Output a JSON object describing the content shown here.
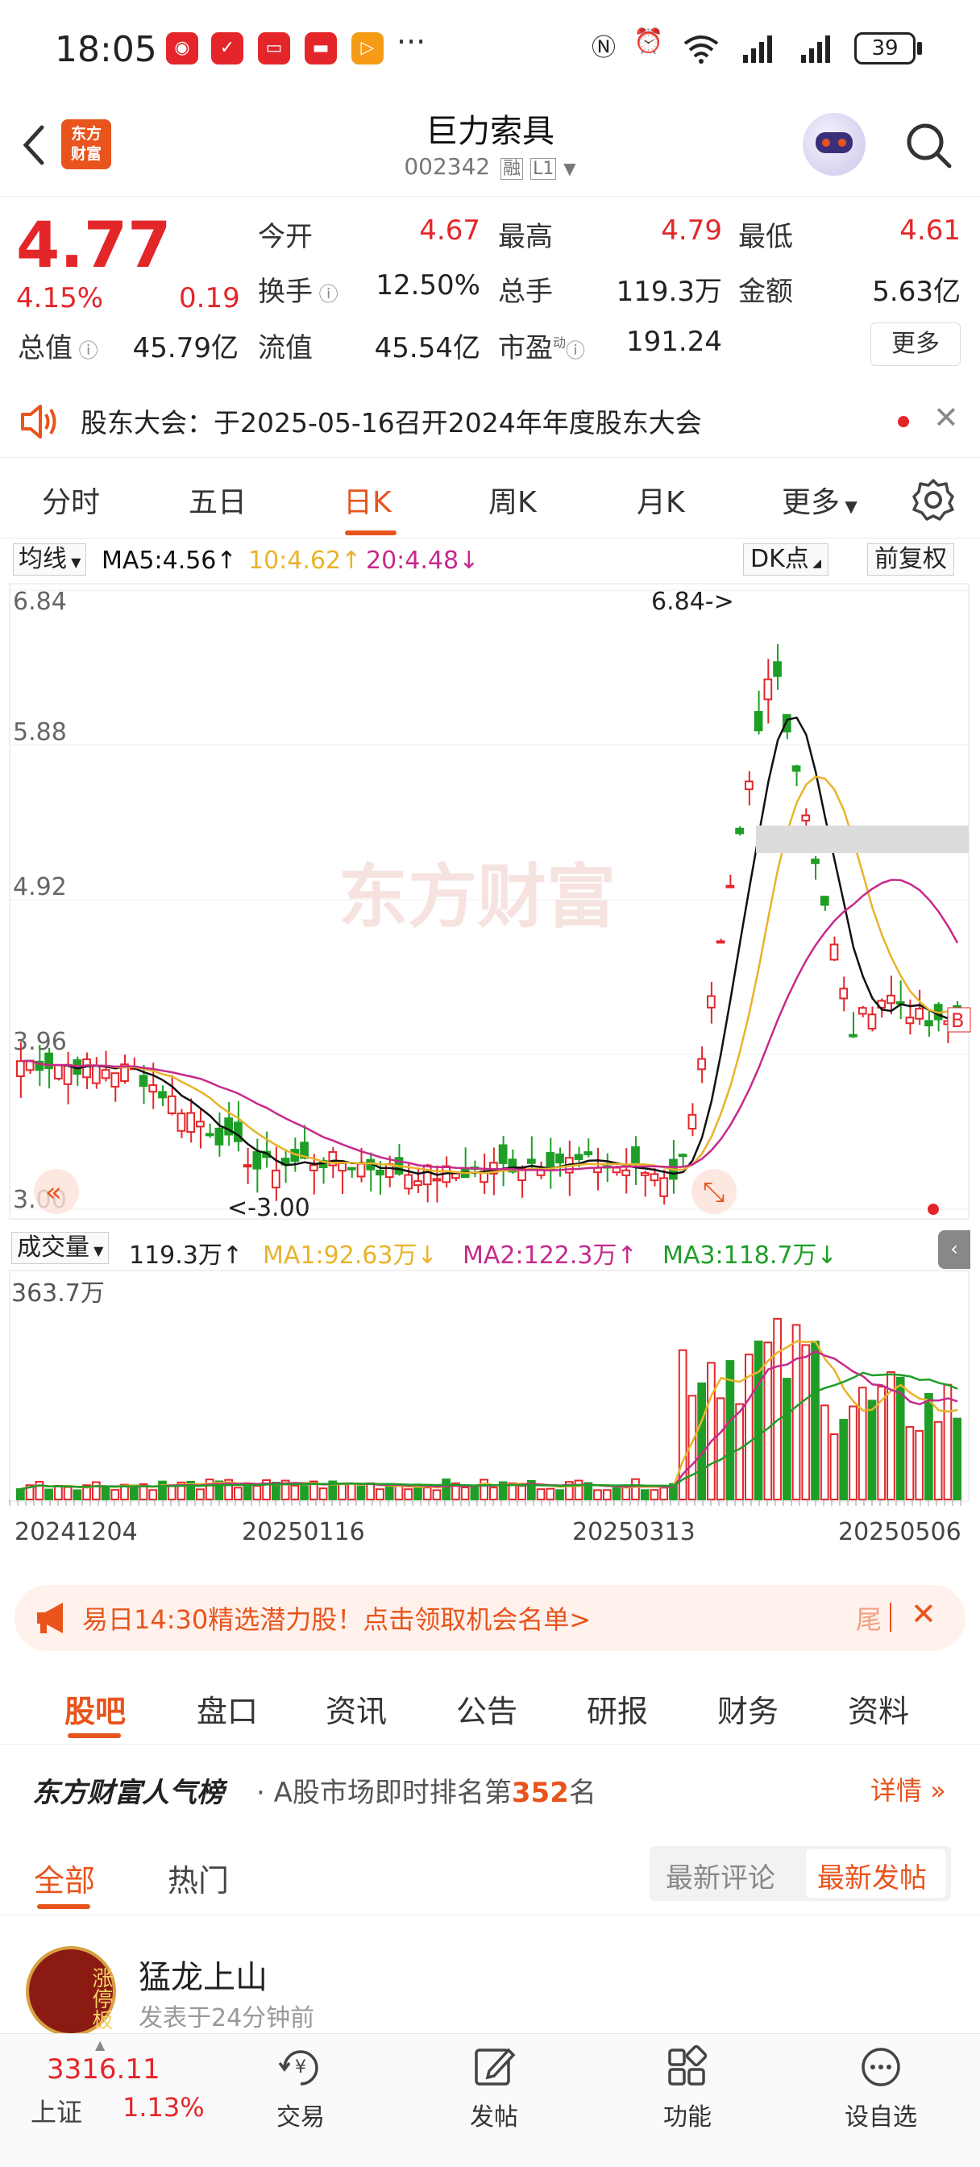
{
  "status": {
    "time": "18:05",
    "battery": "39"
  },
  "header": {
    "logo_line1": "东方",
    "logo_line2": "财富",
    "title": "巨力索具",
    "code": "002342",
    "tag1": "融",
    "tag2": "L1"
  },
  "quote": {
    "price": "4.77",
    "pct": "4.15%",
    "change": "0.19",
    "fields": [
      {
        "label": "今开",
        "value": "4.67",
        "red": true
      },
      {
        "label": "最高",
        "value": "4.79",
        "red": true
      },
      {
        "label": "最低",
        "value": "4.61",
        "red": true
      },
      {
        "label": "换手",
        "value": "12.50%",
        "red": false
      },
      {
        "label": "总手",
        "value": "119.3万",
        "red": false
      },
      {
        "label": "金额",
        "value": "5.63亿",
        "red": false
      },
      {
        "label": "总值",
        "value": "45.79亿",
        "red": false
      },
      {
        "label": "流值",
        "value": "45.54亿",
        "red": false
      },
      {
        "label": "市盈",
        "value": "191.24",
        "red": false
      }
    ],
    "more": "更多",
    "pe_sup": "动"
  },
  "notice": {
    "text": "股东大会：于2025-05-16召开2024年年度股东大会"
  },
  "tabs": [
    "分时",
    "五日",
    "日K",
    "周K",
    "月K",
    "更多"
  ],
  "ma": {
    "selector": "均线",
    "ma5": "MA5:4.56↑",
    "ma10": "10:4.62↑",
    "ma20": "20:4.48↓",
    "dk": "DK点",
    "fq": "前复权"
  },
  "chart_data": {
    "type": "candlestick",
    "y_ticks": [
      "6.84",
      "5.88",
      "4.92",
      "3.96",
      "3.00"
    ],
    "ylim": [
      3.0,
      6.84
    ],
    "high_label": "6.84->",
    "low_label": "<-3.00",
    "watermark": "东方财富",
    "x_ticks": [
      "20241204",
      "20250116",
      "20250313",
      "20250506"
    ],
    "volume": {
      "selector": "成交量",
      "value": "119.3万↑",
      "ma1": "MA1:92.63万↓",
      "ma2": "MA2:122.3万↑",
      "ma3": "MA3:118.7万↓",
      "max": "363.7万"
    },
    "b_marker": "B"
  },
  "colors": {
    "up": "#e3262a",
    "down": "#1f9e27",
    "ma5": "#111111",
    "ma10": "#e9b32b",
    "ma20": "#c62a8c",
    "accent": "#e8541c"
  },
  "banner": {
    "text": "易日14:30精选潜力股！点击领取机会名单>",
    "tail": "尾"
  },
  "content_tabs": [
    "股吧",
    "盘口",
    "资讯",
    "公告",
    "研报",
    "财务",
    "资料"
  ],
  "rank": {
    "brand": "东方财富人气榜",
    "text": "· A股市场即时排名第",
    "num": "352",
    "suffix": "名",
    "detail": "详情"
  },
  "filter": {
    "all": "全部",
    "hot": "热门",
    "latest_comment": "最新评论",
    "latest_post": "最新发帖"
  },
  "post": {
    "user": "猛龙上山",
    "time": "发表于24分钟前",
    "avatar_text": "涨停板"
  },
  "bottom_nav": {
    "index_value": "3316.11",
    "index_name": "上证",
    "index_pct": "1.13%",
    "items": [
      "交易",
      "发帖",
      "功能",
      "设自选"
    ]
  }
}
